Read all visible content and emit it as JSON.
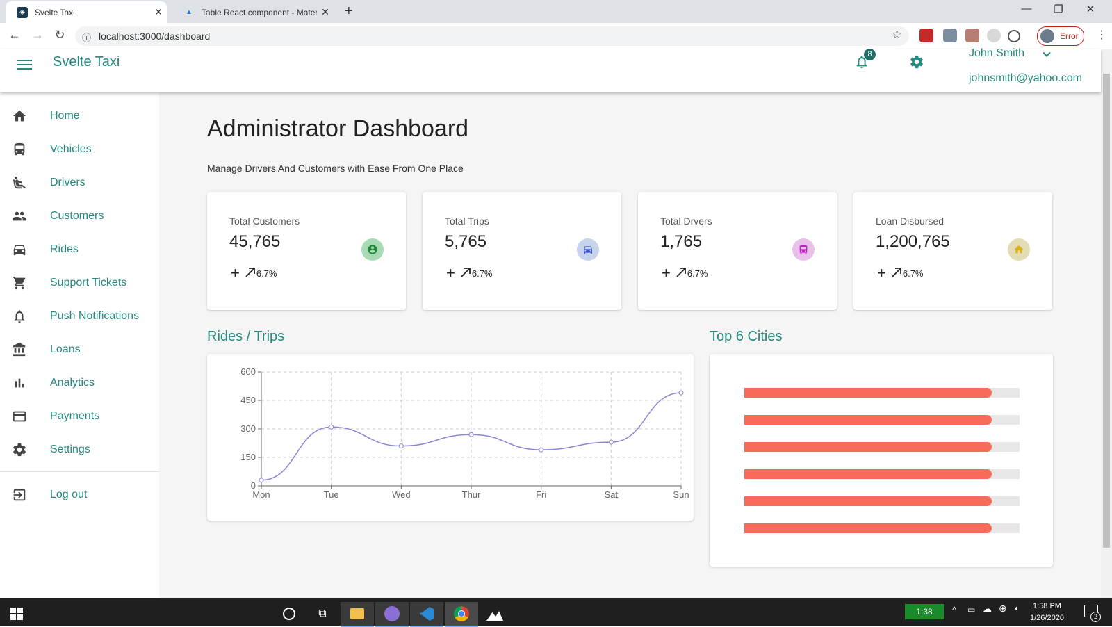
{
  "browser": {
    "tabs": [
      {
        "title": "Svelte Taxi",
        "active": true
      },
      {
        "title": "Table React component - Materia",
        "active": false
      }
    ],
    "url": "localhost:3000/dashboard",
    "profile_status": "Error"
  },
  "header": {
    "brand": "Svelte Taxi",
    "notification_count": "8",
    "user_name": "John Smith",
    "user_email": "johnsmith@yahoo.com"
  },
  "sidebar": {
    "items": [
      {
        "label": "Home",
        "icon": "home-icon"
      },
      {
        "label": "Vehicles",
        "icon": "bus-icon"
      },
      {
        "label": "Drivers",
        "icon": "seat-icon"
      },
      {
        "label": "Customers",
        "icon": "people-icon"
      },
      {
        "label": "Rides",
        "icon": "car-icon"
      },
      {
        "label": "Support Tickets",
        "icon": "cart-icon"
      },
      {
        "label": "Push Notifications",
        "icon": "bell-icon"
      },
      {
        "label": "Loans",
        "icon": "bank-icon"
      },
      {
        "label": "Analytics",
        "icon": "bar-chart-icon"
      },
      {
        "label": "Payments",
        "icon": "credit-card-icon"
      },
      {
        "label": "Settings",
        "icon": "gear-icon"
      }
    ],
    "logout": {
      "label": "Log out",
      "icon": "logout-icon"
    }
  },
  "main": {
    "title": "Administrator Dashboard",
    "subtitle": "Manage Drivers And Customers with Ease From One Place",
    "cards": [
      {
        "label": "Total Customers",
        "value": "45,765",
        "trend": "6.7%",
        "icon": "account-icon",
        "icon_bg": "#a8dab4",
        "icon_color": "#1b8a3a"
      },
      {
        "label": "Total Trips",
        "value": "5,765",
        "trend": "6.7%",
        "icon": "car-icon",
        "icon_bg": "#c7d3ea",
        "icon_color": "#3b4fd6"
      },
      {
        "label": "Total Drvers",
        "value": "1,765",
        "trend": "6.7%",
        "icon": "bus-icon",
        "icon_bg": "#e8c0ea",
        "icon_color": "#c51ec8"
      },
      {
        "label": "Loan Disbursed",
        "value": "1,200,765",
        "trend": "6.7%",
        "icon": "home-icon",
        "icon_bg": "#e3dcb4",
        "icon_color": "#d9b21e"
      }
    ],
    "rides_section_title": "Rides / Trips",
    "cities_section_title": "Top 6 Cities"
  },
  "chart_data": [
    {
      "type": "line",
      "x": [
        "Mon",
        "Tue",
        "Wed",
        "Thur",
        "Fri",
        "Sat",
        "Sun"
      ],
      "series": [
        {
          "values": [
            30,
            310,
            210,
            270,
            190,
            230,
            490
          ],
          "color": "#8884d8"
        }
      ],
      "yticks": [
        0,
        150,
        300,
        450,
        600
      ],
      "ylim": [
        0,
        600
      ],
      "grid": true
    },
    {
      "type": "bar",
      "orientation": "horizontal",
      "values": [
        0.9,
        0.9,
        0.9,
        0.9,
        0.9,
        0.9
      ],
      "fill_color": "#f76b5a",
      "track_color": "#e8e6e6"
    }
  ],
  "taskbar": {
    "time": "1:58 PM",
    "date": "1/26/2020",
    "battery_time": "1:38",
    "notification_count": "2"
  },
  "colors": {
    "accent": "#26897f"
  }
}
